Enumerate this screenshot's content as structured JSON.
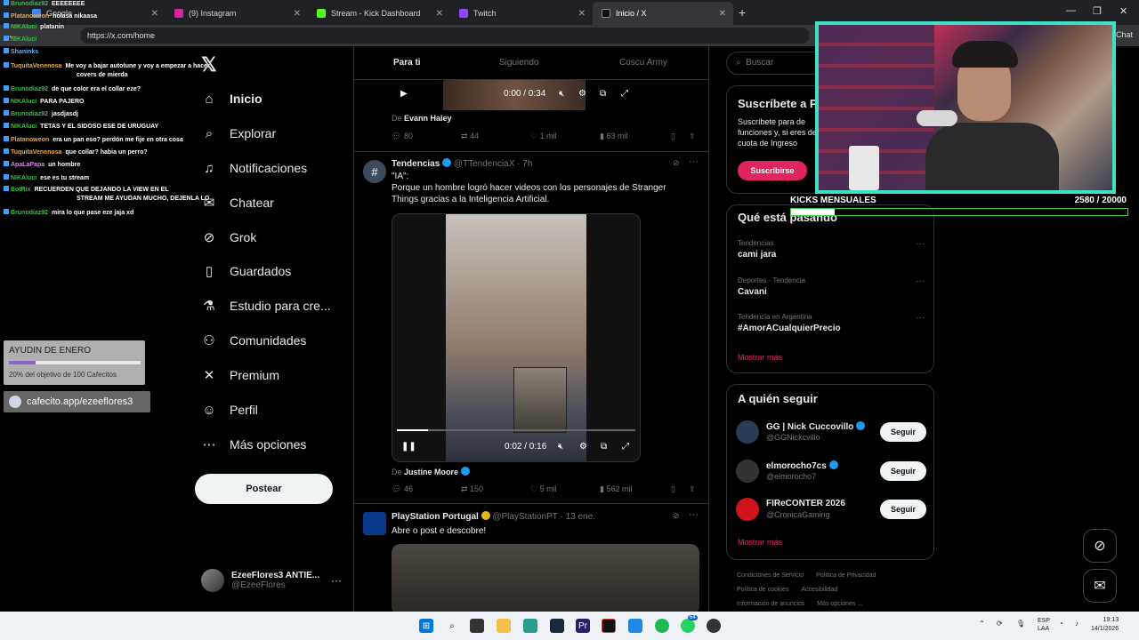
{
  "browser": {
    "tabs": [
      {
        "label": "Google",
        "icon": "google-icon",
        "color": "#4285f4"
      },
      {
        "label": "(9) Instagram",
        "icon": "instagram-icon",
        "color": "#d6249f"
      },
      {
        "label": "Stream - Kick Dashboard",
        "icon": "kick-icon",
        "color": "#53fc18"
      },
      {
        "label": "Twitch",
        "icon": "twitch-icon",
        "color": "#9146ff"
      },
      {
        "label": "Inicio / X",
        "icon": "x-icon",
        "color": "#000000"
      }
    ],
    "url": "https://x.com/home",
    "chat_label": "Chat"
  },
  "nav": {
    "items": [
      {
        "label": "Inicio",
        "icon": "home-icon",
        "glyph": "⌂"
      },
      {
        "label": "Explorar",
        "icon": "search-icon",
        "glyph": "⌕"
      },
      {
        "label": "Notificaciones",
        "icon": "bell-icon",
        "glyph": "♫"
      },
      {
        "label": "Chatear",
        "icon": "chat-icon",
        "glyph": "✉"
      },
      {
        "label": "Grok",
        "icon": "grok-icon",
        "glyph": "⊘"
      },
      {
        "label": "Guardados",
        "icon": "bookmark-icon",
        "glyph": "▯"
      },
      {
        "label": "Estudio para cre...",
        "icon": "studio-icon",
        "glyph": "⚗"
      },
      {
        "label": "Comunidades",
        "icon": "communities-icon",
        "glyph": "⚇"
      },
      {
        "label": "Premium",
        "icon": "x-premium-icon",
        "glyph": "✕"
      },
      {
        "label": "Perfil",
        "icon": "profile-icon",
        "glyph": "☺"
      },
      {
        "label": "Más opciones",
        "icon": "more-icon",
        "glyph": "⋯"
      }
    ],
    "post_label": "Postear",
    "account": {
      "name": "EzeeFlores3 ANTIE...",
      "handle": "@EzeeFlores"
    }
  },
  "timeline": {
    "tabs": [
      "Para ti",
      "Siguiendo",
      "Coscu Army"
    ],
    "video1": {
      "time": "0:00 / 0:34",
      "from_prefix": "De",
      "from": "Evann Haley"
    },
    "stats1": {
      "replies": "80",
      "retweets": "44",
      "likes": "1 mil",
      "views": "63 mil"
    },
    "tweet2": {
      "name": "Tendencias",
      "handle": "@TTendenciaX",
      "time": "7h",
      "text_line1": "\"IA\":",
      "text_line2": "Porque un hombre logró hacer videos con los personajes de Stranger Things gracias a la Inteligencia Artificial.",
      "video_time": "0:02 / 0:16",
      "progress": 0.13,
      "from_prefix": "De",
      "from": "Justine Moore",
      "stats": {
        "replies": "46",
        "retweets": "150",
        "likes": "5 mil",
        "views": "562 mil"
      }
    },
    "tweet3": {
      "name": "PlayStation Portugal",
      "handle": "@PlayStationPT",
      "time": "13 ene.",
      "text": "Abre o post e descobre!"
    }
  },
  "right": {
    "search_placeholder": "Buscar",
    "subscribe": {
      "title": "Suscríbete a P",
      "body": "Suscríbete para de funciones y, si eres de cuota de Ingreso",
      "button": "Suscribirse"
    },
    "happening": {
      "title": "Qué está pasando",
      "trends": [
        {
          "category": "Tendencias",
          "name": "cami jara"
        },
        {
          "category": "Deportes · Tendencia",
          "name": "Cavani"
        },
        {
          "category": "Tendencia en Argentina",
          "name": "#AmorACualquierPrecio"
        }
      ],
      "show_more": "Mostrar más"
    },
    "who_to_follow": {
      "title": "A quién seguir",
      "accounts": [
        {
          "name": "GG | Nick Cuccovillo",
          "handle": "@GGNickcvillo",
          "button": "Seguir",
          "color": "#2a3b55"
        },
        {
          "name": "elmorocho7cs",
          "handle": "@elmorocho7",
          "button": "Seguir",
          "color": "#333333"
        },
        {
          "name": "FIReCONTER 2026",
          "handle": "@CronicaGaming",
          "button": "Seguir",
          "color": "#d0141b"
        }
      ],
      "show_more": "Mostrar más"
    },
    "footer": [
      "Condiciones de Servicio",
      "Política de Privacidad",
      "Política de cookies",
      "Accesibilidad",
      "Información de anuncios",
      "Más opciones ..."
    ]
  },
  "overlay": {
    "chat": [
      {
        "user": "Brunodiaz92",
        "msg": "EEEEEEEE",
        "color": "green"
      },
      {
        "user": "Platanoweon",
        "msg": "holasa nikaasa",
        "color": "orange"
      },
      {
        "user": "NIKAluci",
        "msg": "platanin",
        "color": "green"
      },
      {
        "user": "NIKAluci",
        "msg": "",
        "color": "green"
      },
      {
        "user": "Shaninks",
        "msg": "",
        "color": "lblue"
      },
      {
        "user": "TuquitaVenenosa",
        "msg": "Me voy a bajar autotune y voy a empezar a hacer",
        "color": "orange"
      },
      {
        "user": "",
        "msg": "covers de mierda",
        "color": "orange"
      },
      {
        "user": "Brunodiaz92",
        "msg": "de que color era el collar eze?",
        "color": "green"
      },
      {
        "user": "NIKAluci",
        "msg": "PARA PAJERO",
        "color": "green"
      },
      {
        "user": "Brunodiaz92",
        "msg": "jasdjasdj",
        "color": "green"
      },
      {
        "user": "NIKAluci",
        "msg": "TETAS Y EL SIDOSO ESE DE URUGUAY",
        "color": "green"
      },
      {
        "user": "Platanoweon",
        "msg": "era un pan eso? perdón me fije en otra cosa",
        "color": "orange"
      },
      {
        "user": "TuquitaVenenosa",
        "msg": "que collar? habia un perro?",
        "color": "orange"
      },
      {
        "user": "ApaLaPapa",
        "msg": "un hombre",
        "color": "pink"
      },
      {
        "user": "NIKAluci",
        "msg": "ese es tu stream",
        "color": "green"
      },
      {
        "user": "BotRix",
        "msg": "RECUERDEN QUE DEJANDO LA VIEW EN EL",
        "color": "green"
      },
      {
        "user": "",
        "msg": "STREAM ME AYUDAN MUCHO, DEJENLA LO",
        "color": "green"
      },
      {
        "user": "Brunodiaz92",
        "msg": "mira lo que pase eze jaja xd",
        "color": "green"
      }
    ],
    "goal": {
      "title": "AYUDIN DE ENERO",
      "subtitle": "20% del objetivo de 100 Cafecitos",
      "progress": 0.2
    },
    "cafecito": "cafecito.app/ezeeflores3",
    "kicks": {
      "label": "KICKS MENSUALES",
      "value": "2580  / 20000",
      "progress": 0.129
    }
  },
  "taskbar": {
    "lang1": "ESP",
    "lang2": "LAA",
    "time": "19:13",
    "date": "14/1/2026",
    "badge": "64"
  }
}
